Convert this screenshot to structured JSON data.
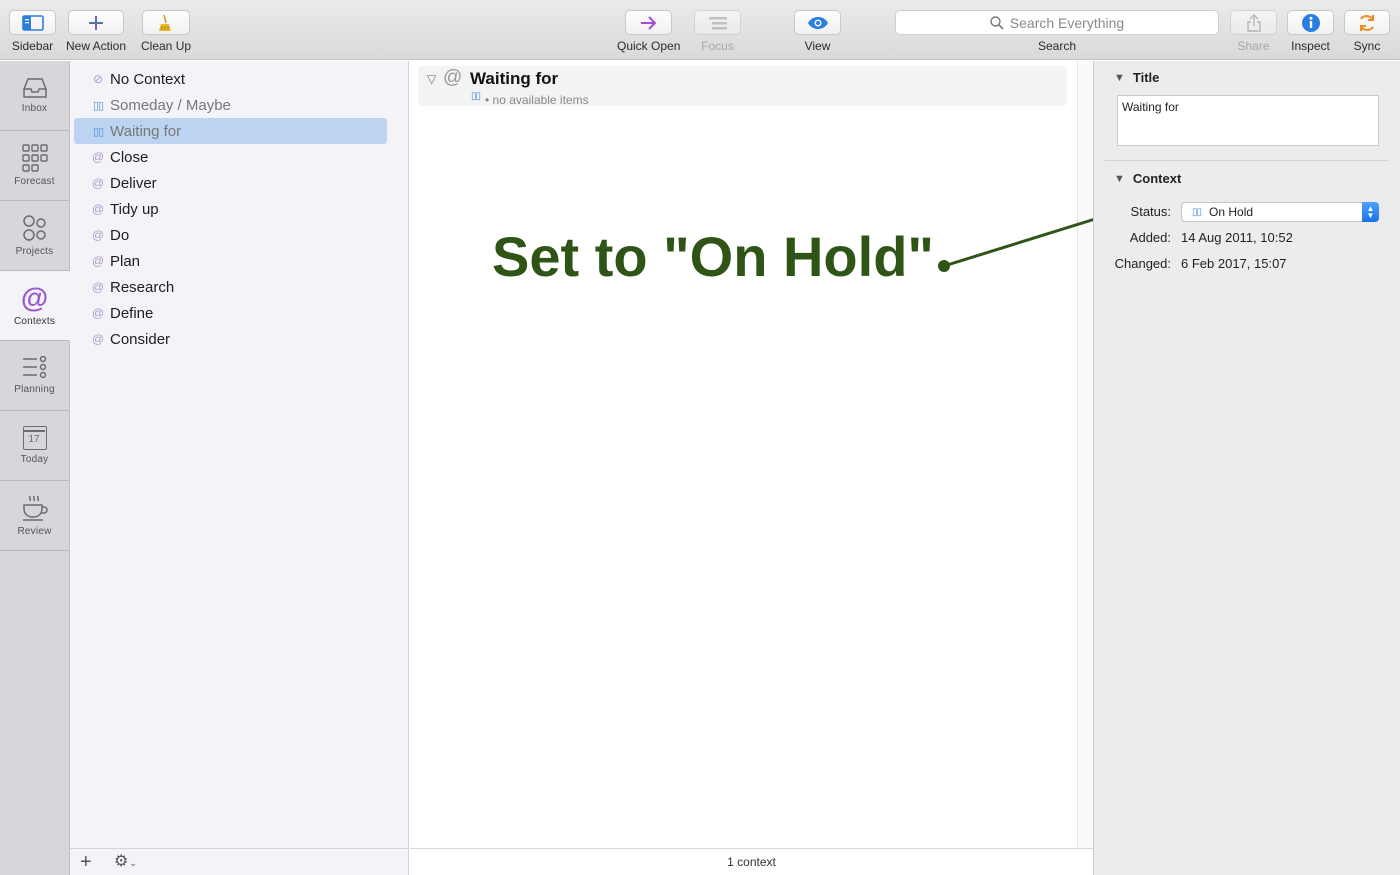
{
  "toolbar": {
    "sidebar": "Sidebar",
    "new_action": "New Action",
    "clean_up": "Clean Up",
    "quick_open": "Quick Open",
    "focus": "Focus",
    "view": "View",
    "search_placeholder": "Search Everything",
    "search": "Search",
    "share": "Share",
    "inspect": "Inspect",
    "sync": "Sync"
  },
  "perspectives": {
    "inbox": "Inbox",
    "forecast": "Forecast",
    "projects": "Projects",
    "contexts": "Contexts",
    "planning": "Planning",
    "today": "Today",
    "today_day": "17",
    "review": "Review"
  },
  "contexts": [
    {
      "label": "No Context",
      "icon": "no-context-icon"
    },
    {
      "label": "Someday / Maybe",
      "icon": "pause-icon"
    },
    {
      "label": "Waiting for",
      "icon": "pause-icon"
    },
    {
      "label": "Close",
      "icon": "at-icon"
    },
    {
      "label": "Deliver",
      "icon": "at-icon"
    },
    {
      "label": "Tidy up",
      "icon": "at-icon"
    },
    {
      "label": "Do",
      "icon": "at-icon"
    },
    {
      "label": "Plan",
      "icon": "at-icon"
    },
    {
      "label": "Research",
      "icon": "at-icon"
    },
    {
      "label": "Define",
      "icon": "at-icon"
    },
    {
      "label": "Consider",
      "icon": "at-icon"
    }
  ],
  "main": {
    "header_title": "Waiting for",
    "header_sub": "• no available items",
    "footer": "1 context"
  },
  "annotation": "Set to \"On Hold\"",
  "inspector": {
    "title_section": "Title",
    "title_value": "Waiting for",
    "context_section": "Context",
    "status_label": "Status:",
    "status_value": "On Hold",
    "added_label": "Added:",
    "added_value": "14 Aug 2011, 10:52",
    "changed_label": "Changed:",
    "changed_value": "6 Feb 2017, 15:07"
  },
  "colors": {
    "accent": "#4a90d9",
    "annotation": "#2e5416",
    "selection": "#bcd4f2",
    "contexts_purple": "#9b59d0"
  }
}
